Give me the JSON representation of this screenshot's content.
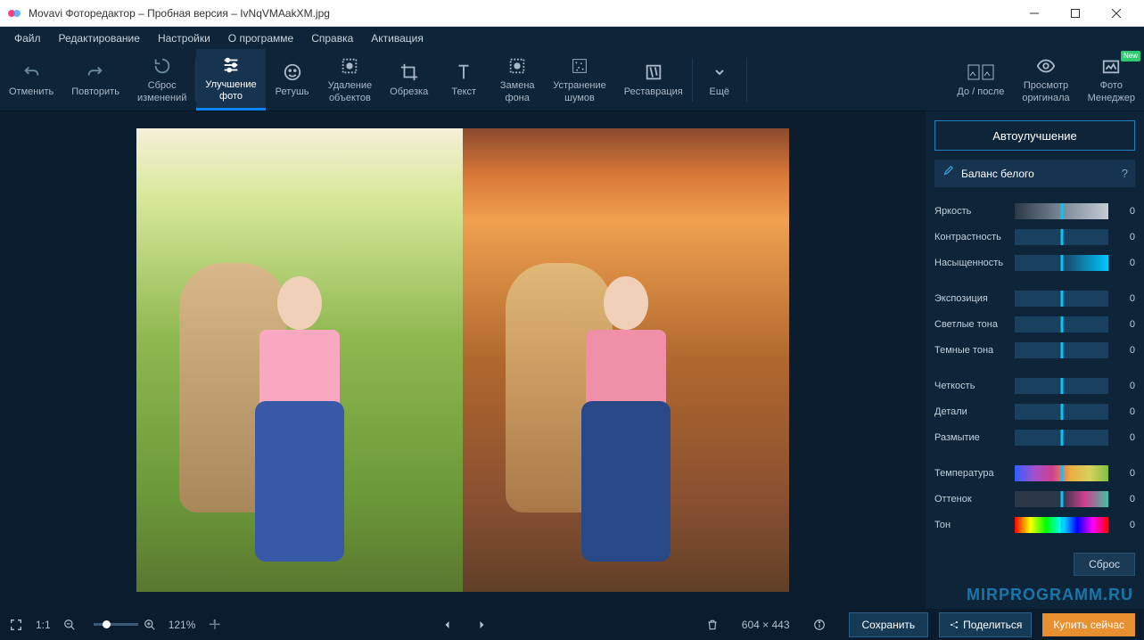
{
  "titlebar": {
    "title": "Movavi Фоторедактор – Пробная версия – IvNqVMAakXM.jpg"
  },
  "menu": [
    "Файл",
    "Редактирование",
    "Настройки",
    "О программе",
    "Справка",
    "Активация"
  ],
  "toolbar": {
    "undo": "Отменить",
    "redo": "Повторить",
    "reset": "Сброс\nизменений",
    "enhance": "Улучшение\nфото",
    "retouch": "Ретушь",
    "remove": "Удаление\nобъектов",
    "crop": "Обрезка",
    "text": "Текст",
    "bg": "Замена\nфона",
    "noise": "Устранение\nшумов",
    "restore": "Реставрация",
    "more": "Ещё",
    "beforeafter": "До / после",
    "original": "Просмотр\nоригинала",
    "manager": "Фото\nМенеджер",
    "new_badge": "New"
  },
  "panel": {
    "auto": "Автоулучшение",
    "wb": "Баланс белого",
    "sliders": {
      "brightness": {
        "label": "Яркость",
        "value": "0"
      },
      "contrast": {
        "label": "Контрастность",
        "value": "0"
      },
      "saturation": {
        "label": "Насыщенность",
        "value": "0"
      },
      "exposure": {
        "label": "Экспозиция",
        "value": "0"
      },
      "highlights": {
        "label": "Светлые тона",
        "value": "0"
      },
      "shadows": {
        "label": "Темные тона",
        "value": "0"
      },
      "sharpness": {
        "label": "Четкость",
        "value": "0"
      },
      "details": {
        "label": "Детали",
        "value": "0"
      },
      "blur": {
        "label": "Размытие",
        "value": "0"
      },
      "temperature": {
        "label": "Температура",
        "value": "0"
      },
      "tint": {
        "label": "Оттенок",
        "value": "0"
      },
      "hue": {
        "label": "Тон",
        "value": "0"
      }
    },
    "reset": "Сброс",
    "help": "?"
  },
  "statusbar": {
    "scale_11": "1:1",
    "zoom": "121%",
    "dimensions": "604 × 443",
    "save": "Сохранить",
    "share": "Поделиться",
    "buy": "Купить сейчас"
  },
  "watermark": "MIRPROGRAMM.RU"
}
